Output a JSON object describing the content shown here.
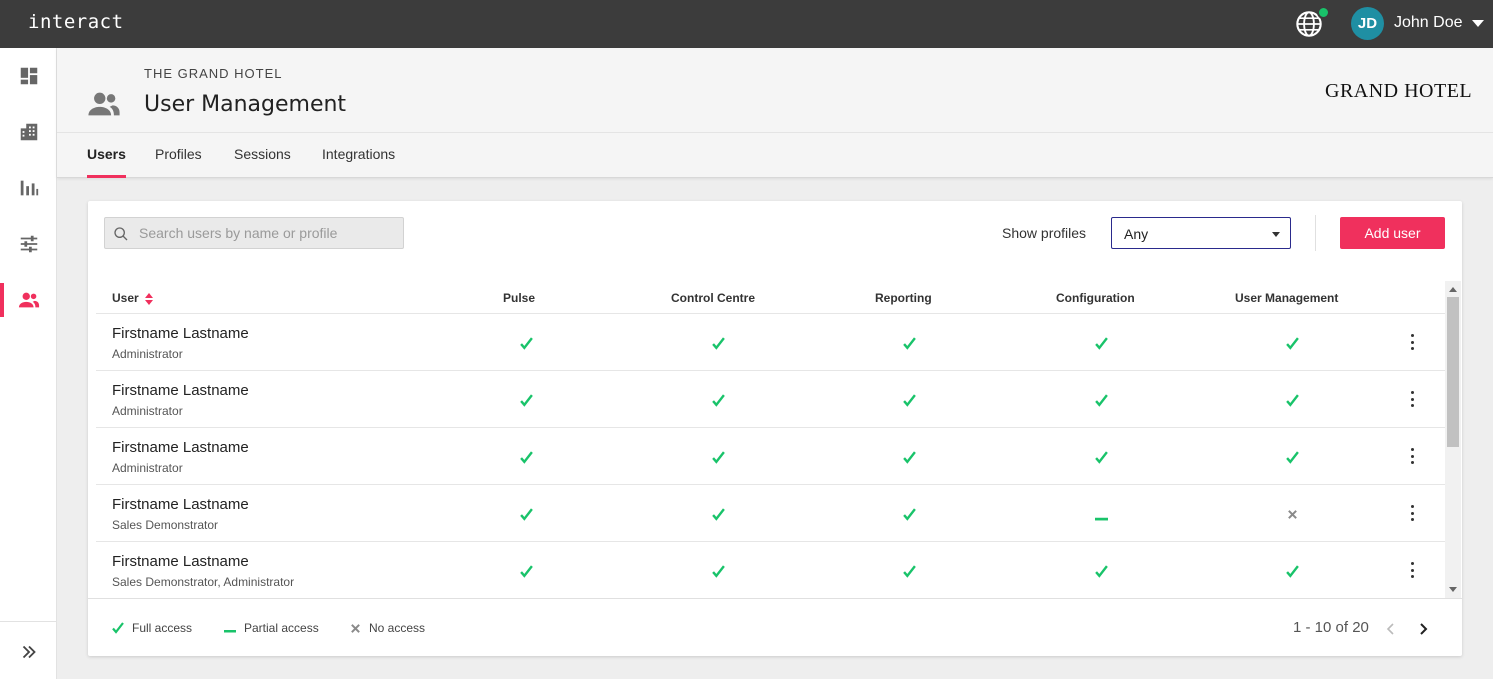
{
  "app": {
    "logo": "interact"
  },
  "topbar": {
    "globe_icon": "globe-icon",
    "status_color": "#19c36a",
    "avatar_initials": "JD",
    "avatar_color": "#1f8fa3",
    "user_name": "John Doe"
  },
  "sidenav": {
    "items": [
      {
        "icon": "dashboard-icon",
        "active": false
      },
      {
        "icon": "building-icon",
        "active": false
      },
      {
        "icon": "bar-chart-icon",
        "active": false
      },
      {
        "icon": "sliders-icon",
        "active": false
      },
      {
        "icon": "users-icon",
        "active": true
      }
    ],
    "expand_icon": "double-chevron-right-icon"
  },
  "header": {
    "hotel_name": "THE GRAND HOTEL",
    "title": "User Management",
    "brand_logo": "GRAND HOTEL",
    "tabs": [
      {
        "label": "Users",
        "active": true
      },
      {
        "label": "Profiles",
        "active": false
      },
      {
        "label": "Sessions",
        "active": false
      },
      {
        "label": "Integrations",
        "active": false
      }
    ]
  },
  "toolbar": {
    "search_placeholder": "Search users by name or profile",
    "show_profiles_label": "Show profiles",
    "show_profiles_value": "Any",
    "add_user_label": "Add user"
  },
  "table": {
    "columns": [
      "User",
      "Pulse",
      "Control Centre",
      "Reporting",
      "Configuration",
      "User Management"
    ],
    "rows": [
      {
        "name": "Firstname Lastname",
        "profile": "Administrator",
        "access": [
          "full",
          "full",
          "full",
          "full",
          "full"
        ]
      },
      {
        "name": "Firstname Lastname",
        "profile": "Administrator",
        "access": [
          "full",
          "full",
          "full",
          "full",
          "full"
        ]
      },
      {
        "name": "Firstname Lastname",
        "profile": "Administrator",
        "access": [
          "full",
          "full",
          "full",
          "full",
          "full"
        ]
      },
      {
        "name": "Firstname Lastname",
        "profile": "Sales Demonstrator",
        "access": [
          "full",
          "full",
          "full",
          "partial",
          "none"
        ]
      },
      {
        "name": "Firstname Lastname",
        "profile": "Sales Demonstrator, Administrator",
        "access": [
          "full",
          "full",
          "full",
          "full",
          "full"
        ]
      }
    ]
  },
  "legend": {
    "full": "Full access",
    "partial": "Partial access",
    "none": "No access"
  },
  "pagination": {
    "text": "1 - 10 of 20"
  },
  "colors": {
    "accent": "#f0305d",
    "check": "#19c36a",
    "none": "#8a8a8a",
    "topbar": "#3c3c3c"
  }
}
